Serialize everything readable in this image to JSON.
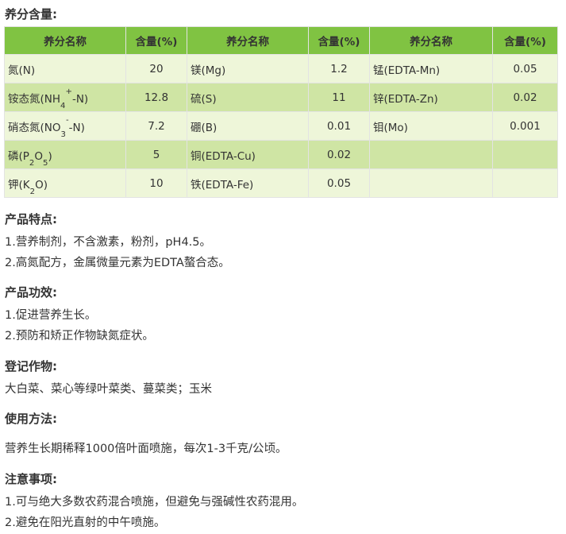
{
  "table_heading": "养分含量:",
  "headers": [
    "养分名称",
    "含量(%)",
    "养分名称",
    "含量(%)",
    "养分名称",
    "含量(%)"
  ],
  "rows": [
    [
      {
        "parts": [
          {
            "t": "氮(N)"
          }
        ]
      },
      "20",
      {
        "parts": [
          {
            "t": "镁(Mg)"
          }
        ]
      },
      "1.2",
      {
        "parts": [
          {
            "t": "锰(EDTA-Mn)"
          }
        ]
      },
      "0.05"
    ],
    [
      {
        "parts": [
          {
            "t": "铵态氮(NH"
          },
          {
            "t": "4",
            "sub": true
          },
          {
            "t": "+",
            "sup": true
          },
          {
            "t": "-N)"
          }
        ]
      },
      "12.8",
      {
        "parts": [
          {
            "t": "硫(S)"
          }
        ]
      },
      "11",
      {
        "parts": [
          {
            "t": "锌(EDTA-Zn)"
          }
        ]
      },
      "0.02"
    ],
    [
      {
        "parts": [
          {
            "t": "硝态氮(NO"
          },
          {
            "t": "3",
            "sub": true
          },
          {
            "t": "-",
            "sup": true
          },
          {
            "t": "-N)"
          }
        ]
      },
      "7.2",
      {
        "parts": [
          {
            "t": "硼(B)"
          }
        ]
      },
      "0.01",
      {
        "parts": [
          {
            "t": "钼(Mo)"
          }
        ]
      },
      "0.001"
    ],
    [
      {
        "parts": [
          {
            "t": "磷(P"
          },
          {
            "t": "2",
            "sub": true
          },
          {
            "t": "O"
          },
          {
            "t": "5",
            "sub": true
          },
          {
            "t": ")"
          }
        ]
      },
      "5",
      {
        "parts": [
          {
            "t": "铜(EDTA-Cu)"
          }
        ]
      },
      "0.02",
      {
        "parts": [
          {
            "t": ""
          }
        ]
      },
      ""
    ],
    [
      {
        "parts": [
          {
            "t": "钾(K"
          },
          {
            "t": "2",
            "sub": true
          },
          {
            "t": "O)"
          }
        ]
      },
      "10",
      {
        "parts": [
          {
            "t": "铁(EDTA-Fe)"
          }
        ]
      },
      "0.05",
      {
        "parts": [
          {
            "t": ""
          }
        ]
      },
      ""
    ]
  ],
  "sections": {
    "features_title": "产品特点:",
    "features_1": "1.营养制剂，不含激素，粉剂，pH4.5。",
    "features_2": "2.高氮配方，金属微量元素为EDTA螯合态。",
    "efficacy_title": "产品功效:",
    "efficacy_1": "1.促进营养生长。",
    "efficacy_2": "2.预防和矫正作物缺氮症状。",
    "crops_title": "登记作物:",
    "crops_1": "大白菜、菜心等绿叶菜类、蔓菜类；玉米",
    "usage_title": "使用方法:",
    "usage_1": "营养生长期稀释1000倍叶面喷施，每次1-3千克/公顷。",
    "notes_title": "注意事项:",
    "notes_1": "1.可与绝大多数农药混合喷施，但避免与强碱性农药混用。",
    "notes_2": "2.避免在阳光直射的中午喷施。"
  },
  "colors": {
    "header_green": "#80c342",
    "row_light": "#eef6d9",
    "row_mid": "#cfe5a4",
    "text": "#333333"
  }
}
